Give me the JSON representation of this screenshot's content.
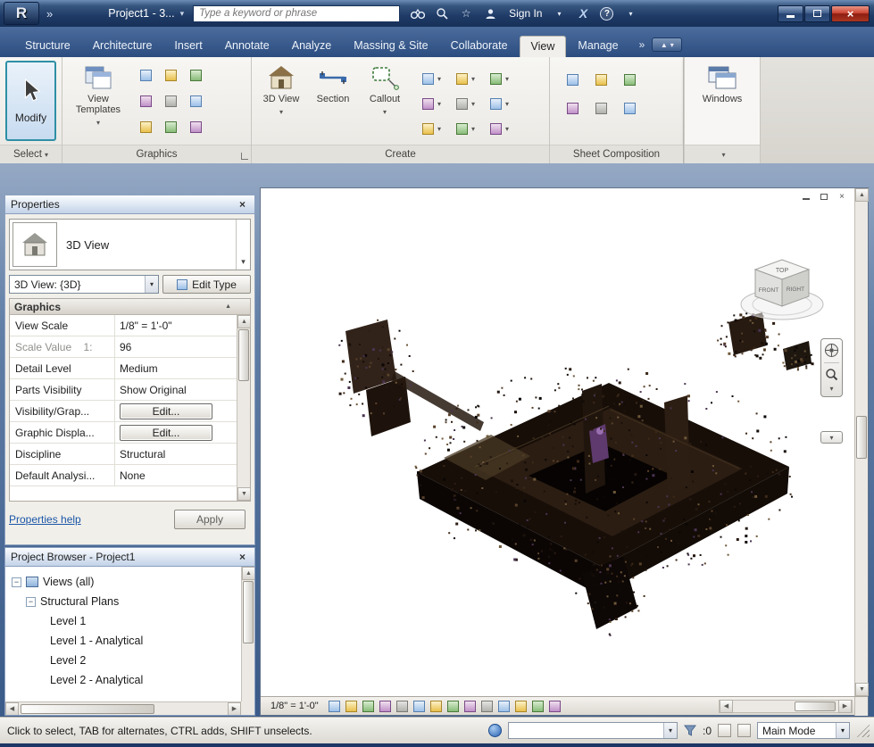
{
  "glyphs": {
    "caret": "▾",
    "chevrons": "»",
    "close": "×",
    "help": "?",
    "star": "☆",
    "left": "◀",
    "right": "▶",
    "up": "▲",
    "down": "▼",
    "dash": "−",
    "app_logo": "R",
    "exchange": "X"
  },
  "titlebar": {
    "title": "Project1 - 3...",
    "search_placeholder": "Type a keyword or phrase",
    "sign_in_label": "Sign In"
  },
  "tabs": [
    {
      "label": "Structure"
    },
    {
      "label": "Architecture"
    },
    {
      "label": "Insert"
    },
    {
      "label": "Annotate"
    },
    {
      "label": "Analyze"
    },
    {
      "label": "Massing & Site"
    },
    {
      "label": "Collaborate"
    },
    {
      "label": "View"
    },
    {
      "label": "Manage"
    }
  ],
  "ribbon": {
    "select_panel": {
      "label": "Select",
      "modify_label": "Modify"
    },
    "graphics_panel": {
      "label": "Graphics",
      "view_templates_label": "View Templates",
      "icons": [
        "visibility-graphics-icon",
        "filters-icon",
        "thin-lines-icon",
        "show-hidden-lines-icon",
        "remove-hidden-lines-icon",
        "cut-profile-icon",
        "render-icon",
        "render-in-cloud-icon",
        "render-gallery-icon"
      ]
    },
    "create_panel": {
      "label": "Create",
      "big": [
        {
          "label": "3D View"
        },
        {
          "label": "Section"
        },
        {
          "label": "Callout"
        }
      ],
      "icons": [
        "plan-views-icon",
        "elevation-icon",
        "drafting-view-icon",
        "duplicate-view-icon",
        "legends-icon",
        "scope-box-icon",
        "schedules-icon",
        "sheet-list-icon",
        "graphical-column-schedule-icon"
      ]
    },
    "sheet_panel": {
      "label": "Sheet Composition",
      "icons": [
        "new-sheet-icon",
        "title-block-icon",
        "revisions-icon",
        "guide-grid-icon",
        "matchline-icon",
        "viewports-icon"
      ]
    },
    "windows_panel": {
      "label": "Windows"
    }
  },
  "properties": {
    "title": "Properties",
    "type_label": "3D View",
    "type_selector": "3D View: {3D}",
    "edit_type_label": "Edit Type",
    "section_header": "Graphics",
    "rows": [
      {
        "label": "View Scale",
        "value": "1/8\" = 1'-0\""
      },
      {
        "label": "Scale Value    1:",
        "value": "96"
      },
      {
        "label": "Detail Level",
        "value": "Medium"
      },
      {
        "label": "Parts Visibility",
        "value": "Show Original"
      },
      {
        "label": "Visibility/Grap...",
        "value": "Edit..."
      },
      {
        "label": "Graphic Displa...",
        "value": "Edit..."
      },
      {
        "label": "Discipline",
        "value": "Structural"
      },
      {
        "label": "Default Analysi...",
        "value": "None"
      }
    ],
    "help_link": "Properties help",
    "apply_label": "Apply"
  },
  "project_browser": {
    "title": "Project Browser - Project1",
    "items": [
      {
        "label": "Views (all)"
      },
      {
        "label": "Structural Plans"
      },
      {
        "label": "Level 1"
      },
      {
        "label": "Level 1 - Analytical"
      },
      {
        "label": "Level 2"
      },
      {
        "label": "Level 2 - Analytical"
      }
    ]
  },
  "viewport": {
    "viewcube": {
      "top": "TOP",
      "front": "FRONT",
      "right": "RIGHT"
    },
    "view_bar": {
      "scale": "1/8\" = 1'-0\"",
      "icons": [
        "detail-level-icon",
        "visual-style-icon",
        "sun-path-icon",
        "shadows-icon",
        "show-rendering-dialog-icon",
        "crop-view-icon",
        "show-crop-region-icon",
        "unlocked-view-icon",
        "temporary-hide-isolate-icon",
        "reveal-hidden-elements-icon",
        "worksharing-display-icon",
        "temporary-view-properties-icon",
        "show-constraints-icon",
        "show-analytical-model-icon"
      ]
    }
  },
  "statusbar": {
    "message": "Click to select, TAB for alternates, CTRL adds, SHIFT unselects.",
    "selection_count": ":0",
    "mode": "Main Mode"
  }
}
